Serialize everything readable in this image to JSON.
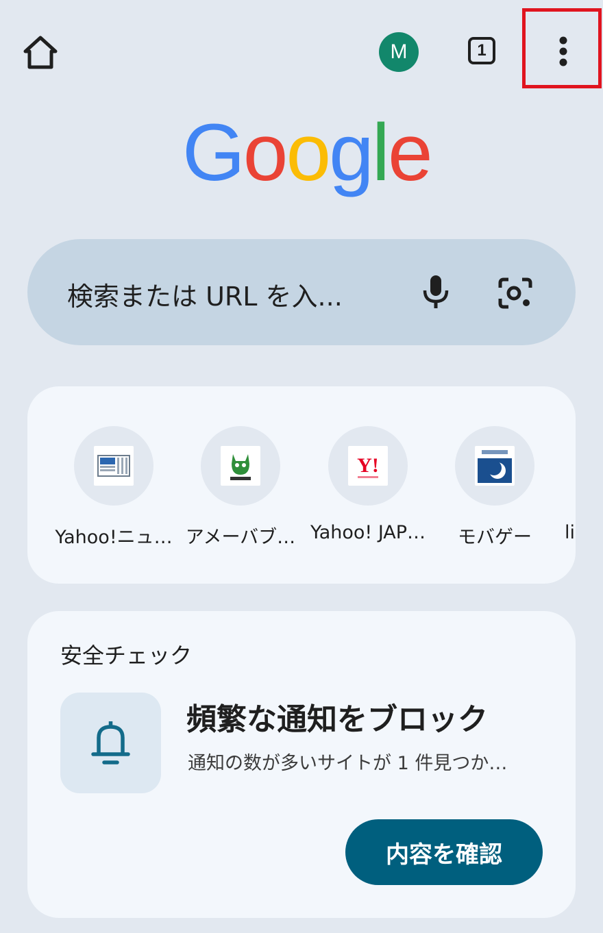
{
  "toolbar": {
    "home_icon": "home-icon",
    "account_initial": "M",
    "account_color": "#12876b",
    "tab_count": "1",
    "menu_icon": "more-vert-icon",
    "highlight_color": "#e0141f"
  },
  "logo": {
    "letters": [
      {
        "char": "G",
        "color": "#4285f4"
      },
      {
        "char": "o",
        "color": "#ea4335"
      },
      {
        "char": "o",
        "color": "#fbbc05"
      },
      {
        "char": "g",
        "color": "#4285f4"
      },
      {
        "char": "l",
        "color": "#34a853"
      },
      {
        "char": "e",
        "color": "#ea4335"
      }
    ]
  },
  "search": {
    "placeholder": "検索または URL を入...",
    "voice_icon": "mic-icon",
    "lens_icon": "lens-camera-icon"
  },
  "shortcuts": [
    {
      "label": "Yahoo!ニュ…",
      "icon": "yahoo-news-icon"
    },
    {
      "label": "アメーバブ…",
      "icon": "ameba-icon"
    },
    {
      "label": "Yahoo! JAP…",
      "icon": "yahoo-japan-icon"
    },
    {
      "label": "モバゲー",
      "icon": "mobage-icon"
    },
    {
      "label": "li",
      "icon": ""
    }
  ],
  "safety_check": {
    "title": "安全チェック",
    "icon": "bell-icon",
    "heading": "頻繁な通知をブロック",
    "description": "通知の数が多いサイトが 1 件見つか…",
    "button": "内容を確認"
  }
}
